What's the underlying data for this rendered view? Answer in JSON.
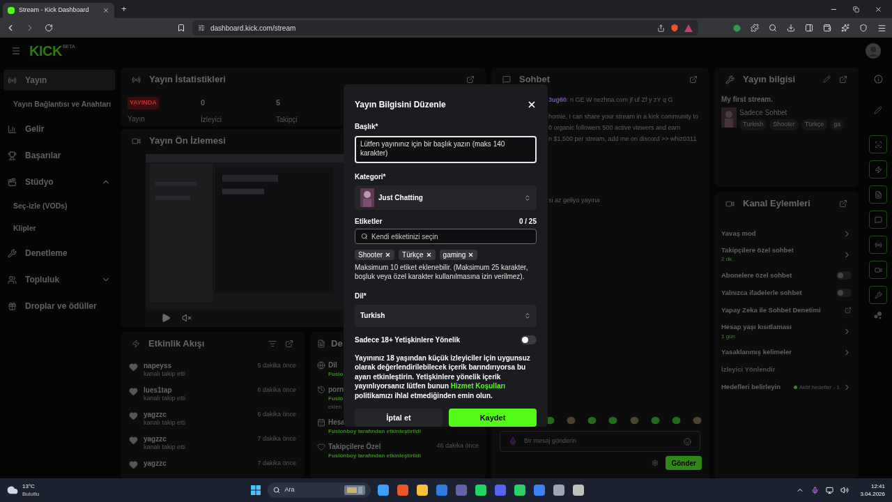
{
  "browser": {
    "tab_title": "Stream - Kick Dashboard",
    "new_tab": "+",
    "url": "dashboard.kick.com/stream"
  },
  "header": {
    "logo": "KICK",
    "badge": "BETA"
  },
  "sidebar": [
    {
      "label": "Yayın",
      "kind": "section",
      "selected": true
    },
    {
      "label": "Yayın Bağlantısı ve Anahtarı",
      "kind": "sub",
      "selected": false
    },
    {
      "label": "Gelir",
      "kind": "section",
      "selected": false
    },
    {
      "label": "Başarılar",
      "kind": "section",
      "selected": false
    },
    {
      "label": "Stüdyo",
      "kind": "group",
      "expanded": true,
      "selected": false
    },
    {
      "label": "Seç-izle (VODs)",
      "kind": "sub",
      "selected": false
    },
    {
      "label": "Klipler",
      "kind": "sub",
      "selected": false
    },
    {
      "label": "Denetleme",
      "kind": "section",
      "selected": false
    },
    {
      "label": "Topluluk",
      "kind": "group",
      "expanded": false,
      "selected": false
    },
    {
      "label": "Droplar ve ödüller",
      "kind": "section",
      "selected": false
    }
  ],
  "stats": {
    "title": "Yayın İstatistikleri",
    "live_badge": "YAYINDA",
    "live_label": "Yayın",
    "items": [
      {
        "value": "0",
        "label": "İzleyici"
      },
      {
        "value": "5",
        "label": "Takipçi"
      }
    ]
  },
  "preview": {
    "title": "Yayın Ön İzlemesi"
  },
  "activity": {
    "title": "Etkinlik Akışı",
    "items": [
      {
        "user": "napeyss",
        "action": "kanalı takip etti",
        "time": "5 dakika önce"
      },
      {
        "user": "lues1tap",
        "action": "kanalı takip etti",
        "time": "6 dakika önce"
      },
      {
        "user": "yagzzc",
        "action": "kanalı takip etti",
        "time": "6 dakika önce"
      },
      {
        "user": "yagzzc",
        "action": "kanalı takip etti",
        "time": "7 dakika önce"
      },
      {
        "user": "yagzzc",
        "time": "7 dakika önce"
      }
    ]
  },
  "details": {
    "title": "De",
    "rows": [
      {
        "title": "Dil",
        "lines": [
          "Fusio"
        ]
      },
      {
        "title": "porn",
        "lines": [
          "Fusio",
          "eklen"
        ]
      },
      {
        "title": "Hesa",
        "lines": [
          "Fusionboy tarafından etkinleştirildi"
        ]
      },
      {
        "title": "Takipçilere Özel",
        "lines": [
          "Fusionboy tarafından etkinleştirildi"
        ],
        "time": "46 dakika önce"
      }
    ]
  },
  "chat": {
    "title": "Sohbet",
    "messages": [
      {
        "user": "3ug60",
        "lines": [
          ": n GE W nezhna.com jf uf Zf y zY q G"
        ]
      },
      {
        "lines": [
          "homie, I can share your stream in a kick community to",
          "0 organic followers 500 active viewers and earn",
          "n $1,500 per stream, add me on discord >> whiz0311"
        ]
      },
      {
        "lines": [
          "si az geliyo yayına"
        ]
      }
    ],
    "placeholder": "Bir mesaj gönderin",
    "send": "Gönder"
  },
  "stream_info": {
    "title": "Yayın bilgisi",
    "stream_title": "My first stream.",
    "category": "Sadece Sohbet",
    "tags": [
      "Turkish",
      "Shooter",
      "Türkçe",
      "ga"
    ]
  },
  "actions": {
    "title": "Kanal Eylemleri",
    "items": [
      {
        "kind": "link",
        "label": "Yavaş mod"
      },
      {
        "kind": "link",
        "label": "Takipçilere özel sohbet",
        "sub": "2 dk."
      },
      {
        "kind": "toggle",
        "label": "Abonelere özel sohbet",
        "on": false
      },
      {
        "kind": "toggle",
        "label": "Yalnızca ifadelerle sohbet",
        "on": false
      },
      {
        "kind": "external",
        "label": "Yapay Zeka ile Sohbet Denetimi"
      },
      {
        "kind": "link",
        "label": "Hesap yaşı kısıtlaması",
        "sub": "1 gün"
      },
      {
        "kind": "link",
        "label": "Yasaklanmış kelimeler"
      },
      {
        "kind": "disabled",
        "label": "İzleyici Yönlendir"
      },
      {
        "kind": "link",
        "label": "Hedefleri belirleyin",
        "status": "Aktif hedefler - 1"
      }
    ]
  },
  "modal": {
    "title": "Yayın Bilgisini Düzenle",
    "title_label": "Başlık*",
    "title_placeholder": "Lütfen yayınınız için bir başlık yazın (maks 140 karakter)",
    "category_label": "Kategori*",
    "category": "Just Chatting",
    "tags_label": "Etiketler",
    "tags_count": "0 / 25",
    "tags_placeholder": "Kendi etiketinizi seçin",
    "tags": [
      "Shooter",
      "Türkçe",
      "gaming"
    ],
    "tags_help": "Maksimum 10 etiket eklenebilir. (Maksimum 25 karakter, boşluk veya özel karakter kullanılmasına izin verilmez).",
    "language_label": "Dil*",
    "language": "Turkish",
    "adult_label": "Sadece 18+ Yetişkinlere Yönelik",
    "adult_on": false,
    "adult_text_before": "Yayınınız 18 yaşından küçük izleyiciler için uygunsuz olarak değerlendirilebilecek içerik barındırıyorsa bu ayarı etkinleştirin. Yetişkinlere yönelik içerik yayınlıyorsanız lütfen bunun ",
    "adult_link": "Hizmet Koşulları",
    "adult_text_after": " politikamızı ihlal etmediğinden emin olun.",
    "cancel": "İptal et",
    "save": "Kaydet"
  },
  "taskbar": {
    "temp": "13°C",
    "weather": "Bulutlu",
    "search": "Ara",
    "time": "12:41",
    "date": "3.04.2026"
  }
}
